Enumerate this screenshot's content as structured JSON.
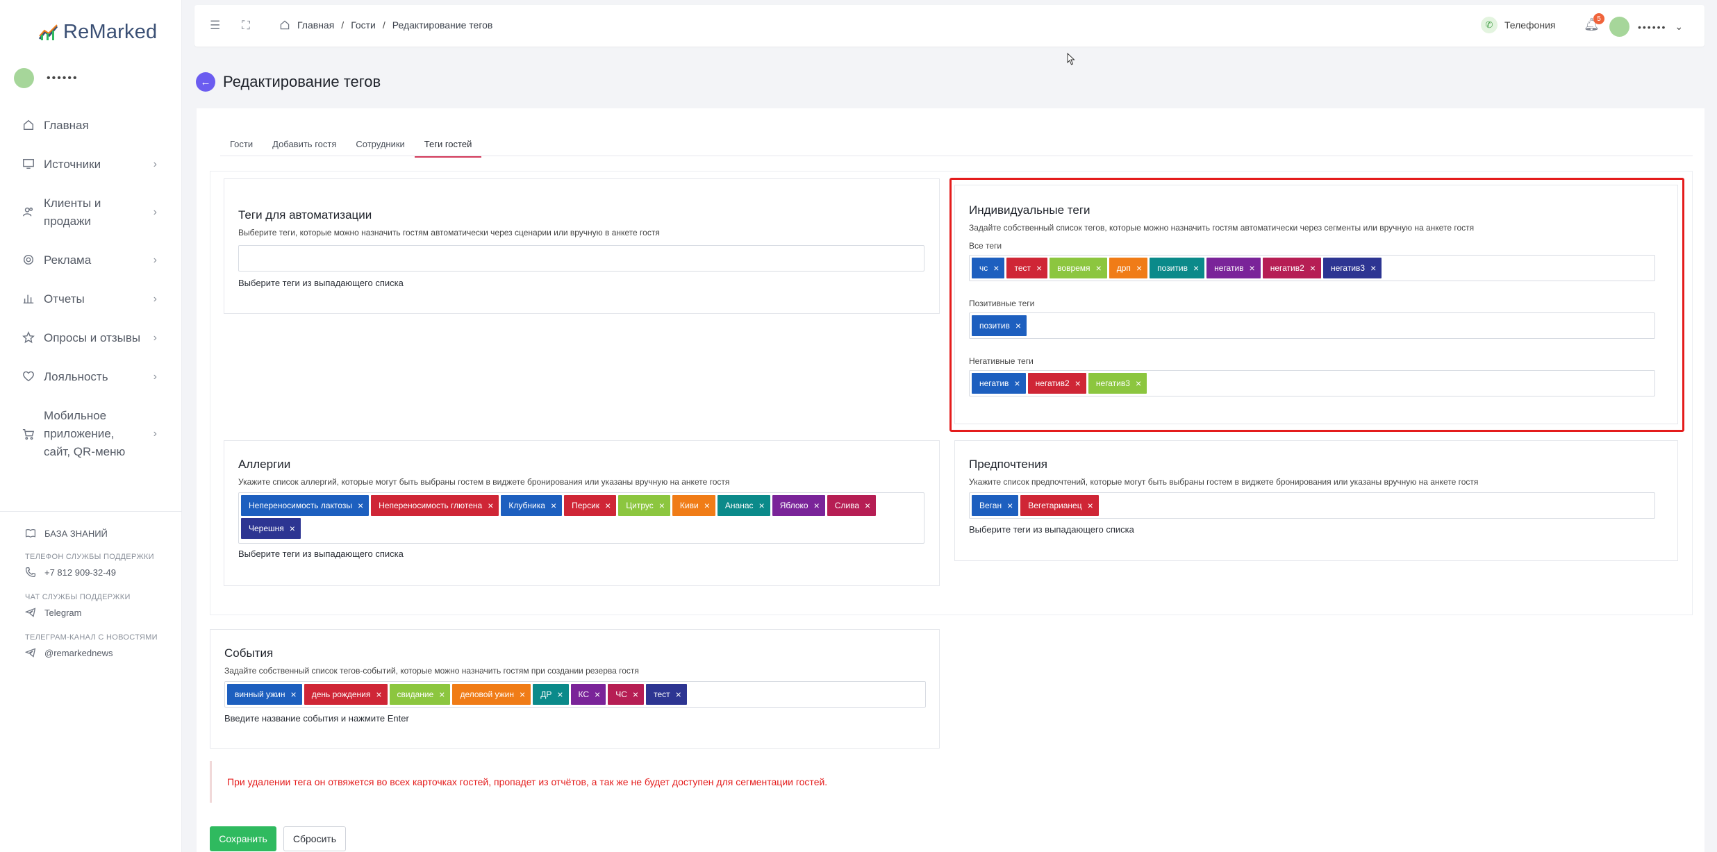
{
  "brand": {
    "name": "ReMarked"
  },
  "user": {
    "name": "••••••"
  },
  "sidebar": {
    "items": [
      {
        "label": "Главная",
        "icon": "home-icon",
        "chevron": false
      },
      {
        "label": "Источники",
        "icon": "monitor-icon",
        "chevron": true
      },
      {
        "label": "Клиенты и продажи",
        "icon": "users-icon",
        "chevron": true
      },
      {
        "label": "Реклама",
        "icon": "target-icon",
        "chevron": true
      },
      {
        "label": "Отчеты",
        "icon": "bar-chart-icon",
        "chevron": true
      },
      {
        "label": "Опросы и отзывы",
        "icon": "star-icon",
        "chevron": true
      },
      {
        "label": "Лояльность",
        "icon": "heart-icon",
        "chevron": true
      },
      {
        "label": "Мобильное приложение, сайт, QR-меню",
        "icon": "cart-icon",
        "chevron": true
      }
    ],
    "knowledge_base": "БАЗА ЗНАНИЙ",
    "support_phone_caption": "ТЕЛЕФОН СЛУЖБЫ ПОДДЕРЖКИ",
    "support_phone": "+7 812 909-32-49",
    "support_chat_caption": "ЧАТ СЛУЖБЫ ПОДДЕРЖКИ",
    "support_chat": "Telegram",
    "news_caption": "ТЕЛЕГРАМ-КАНАЛ С НОВОСТЯМИ",
    "news_channel": "@remarkednews"
  },
  "header": {
    "breadcrumbs": [
      "Главная",
      "Гости",
      "Редактирование тегов"
    ],
    "phone_label": "Телефония",
    "notifications_count": "5",
    "user_name": "••••••"
  },
  "page": {
    "title": "Редактирование тегов",
    "tabs": [
      "Гости",
      "Добавить гостя",
      "Сотрудники",
      "Теги гостей"
    ],
    "active_tab": 3
  },
  "automation": {
    "title": "Теги для автоматизации",
    "desc": "Выберите теги, которые можно назначить гостям автоматически через сценарии или вручную в анкете гостя",
    "hint": "Выберите теги из выпадающего списка"
  },
  "individual": {
    "title": "Индивидуальные теги",
    "desc": "Задайте собственный список тегов, которые можно назначить гостям автоматически через сегменты или вручную на анкете гостя",
    "all_label": "Все теги",
    "all_tags": [
      {
        "text": "чс",
        "color": "#1d5fbf"
      },
      {
        "text": "тест",
        "color": "#cf2636"
      },
      {
        "text": "вовремя",
        "color": "#8cc63f"
      },
      {
        "text": "дрп",
        "color": "#f07c17"
      },
      {
        "text": "позитив",
        "color": "#0b8a8a"
      },
      {
        "text": "негатив",
        "color": "#7a2499"
      },
      {
        "text": "негатив2",
        "color": "#b61e54"
      },
      {
        "text": "негатив3",
        "color": "#2d3592"
      }
    ],
    "positive_label": "Позитивные теги",
    "positive_tags": [
      {
        "text": "позитив",
        "color": "#1d5fbf"
      }
    ],
    "negative_label": "Негативные теги",
    "negative_tags": [
      {
        "text": "негатив",
        "color": "#1d5fbf"
      },
      {
        "text": "негатив2",
        "color": "#cf2636"
      },
      {
        "text": "негатив3",
        "color": "#8cc63f"
      }
    ]
  },
  "allergies": {
    "title": "Аллергии",
    "desc": "Укажите список аллергий, которые могут быть выбраны гостем в виджете бронирования или указаны вручную на анкете гостя",
    "tags": [
      {
        "text": "Непереносимость лактозы",
        "color": "#1d5fbf"
      },
      {
        "text": "Непереносимость глютена",
        "color": "#cf2636"
      },
      {
        "text": "Клубника",
        "color": "#1d5fbf"
      },
      {
        "text": "Персик",
        "color": "#cf2636"
      },
      {
        "text": "Цитрус",
        "color": "#8cc63f"
      },
      {
        "text": "Киви",
        "color": "#f07c17"
      },
      {
        "text": "Ананас",
        "color": "#0b8a8a"
      },
      {
        "text": "Яблоко",
        "color": "#7a2499"
      },
      {
        "text": "Слива",
        "color": "#b61e54"
      },
      {
        "text": "Черешня",
        "color": "#2d3592"
      }
    ],
    "hint": "Выберите теги из выпадающего списка"
  },
  "preferences": {
    "title": "Предпочтения",
    "desc": "Укажите список предпочтений, которые могут быть выбраны гостем в виджете бронирования или указаны вручную на анкете гостя",
    "tags": [
      {
        "text": "Веган",
        "color": "#1d5fbf"
      },
      {
        "text": "Вегетарианец",
        "color": "#cf2636"
      }
    ],
    "hint": "Выберите теги из выпадающего списка"
  },
  "events": {
    "title": "События",
    "desc": "Задайте собственный список тегов-событий, которые можно назначить гостям при создании резерва гостя",
    "tags": [
      {
        "text": "винный ужин",
        "color": "#1d5fbf"
      },
      {
        "text": "день рождения",
        "color": "#cf2636"
      },
      {
        "text": "свидание",
        "color": "#8cc63f"
      },
      {
        "text": "деловой ужин",
        "color": "#f07c17"
      },
      {
        "text": "ДР",
        "color": "#0b8a8a"
      },
      {
        "text": "КС",
        "color": "#7a2499"
      },
      {
        "text": "ЧС",
        "color": "#b61e54"
      },
      {
        "text": "тест",
        "color": "#2d3592"
      }
    ],
    "hint": "Введите название события и нажмите Enter"
  },
  "warning": "При удалении тега он отвяжется во всех карточках гостей, пропадет из отчётов, а так же не будет доступен для сегментации гостей.",
  "actions": {
    "save": "Сохранить",
    "reset": "Сбросить"
  },
  "colors": {
    "accent": "#6b5cf0",
    "save": "#2fba5f",
    "danger": "#e41c1c",
    "active_tab": "#d33a5a"
  }
}
